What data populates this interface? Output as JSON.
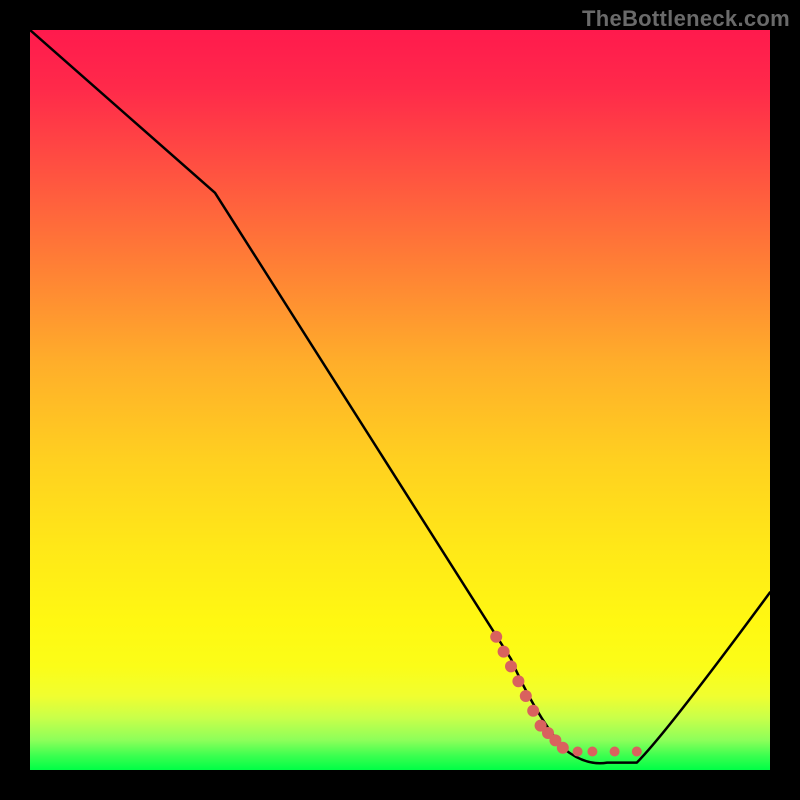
{
  "watermark": "TheBottleneck.com",
  "chart_data": {
    "type": "line",
    "title": "",
    "xlabel": "",
    "ylabel": "",
    "xlim": [
      0,
      100
    ],
    "ylim": [
      0,
      100
    ],
    "series": [
      {
        "name": "curve",
        "points": [
          {
            "x": 0,
            "y": 100
          },
          {
            "x": 25,
            "y": 78
          },
          {
            "x": 65,
            "y": 15
          },
          {
            "x": 68,
            "y": 8
          },
          {
            "x": 72,
            "y": 3
          },
          {
            "x": 78,
            "y": 1
          },
          {
            "x": 82,
            "y": 1
          },
          {
            "x": 86,
            "y": 5
          },
          {
            "x": 100,
            "y": 24
          }
        ]
      }
    ],
    "markers": {
      "name": "highlight-dots",
      "color": "#d9625e",
      "points": [
        {
          "x": 63,
          "y": 18
        },
        {
          "x": 64,
          "y": 16
        },
        {
          "x": 65,
          "y": 14
        },
        {
          "x": 66,
          "y": 12
        },
        {
          "x": 67,
          "y": 10
        },
        {
          "x": 68,
          "y": 8
        },
        {
          "x": 69,
          "y": 6
        },
        {
          "x": 70,
          "y": 5
        },
        {
          "x": 71,
          "y": 4
        },
        {
          "x": 72,
          "y": 3
        },
        {
          "x": 74,
          "y": 2.5
        },
        {
          "x": 76,
          "y": 2.5
        },
        {
          "x": 79,
          "y": 2.5
        },
        {
          "x": 82,
          "y": 2.5
        }
      ]
    },
    "gradient_stops": [
      {
        "offset": 0,
        "color": "#ff1a4d"
      },
      {
        "offset": 50,
        "color": "#ffd020"
      },
      {
        "offset": 90,
        "color": "#fff812"
      },
      {
        "offset": 100,
        "color": "#00ff46"
      }
    ]
  }
}
